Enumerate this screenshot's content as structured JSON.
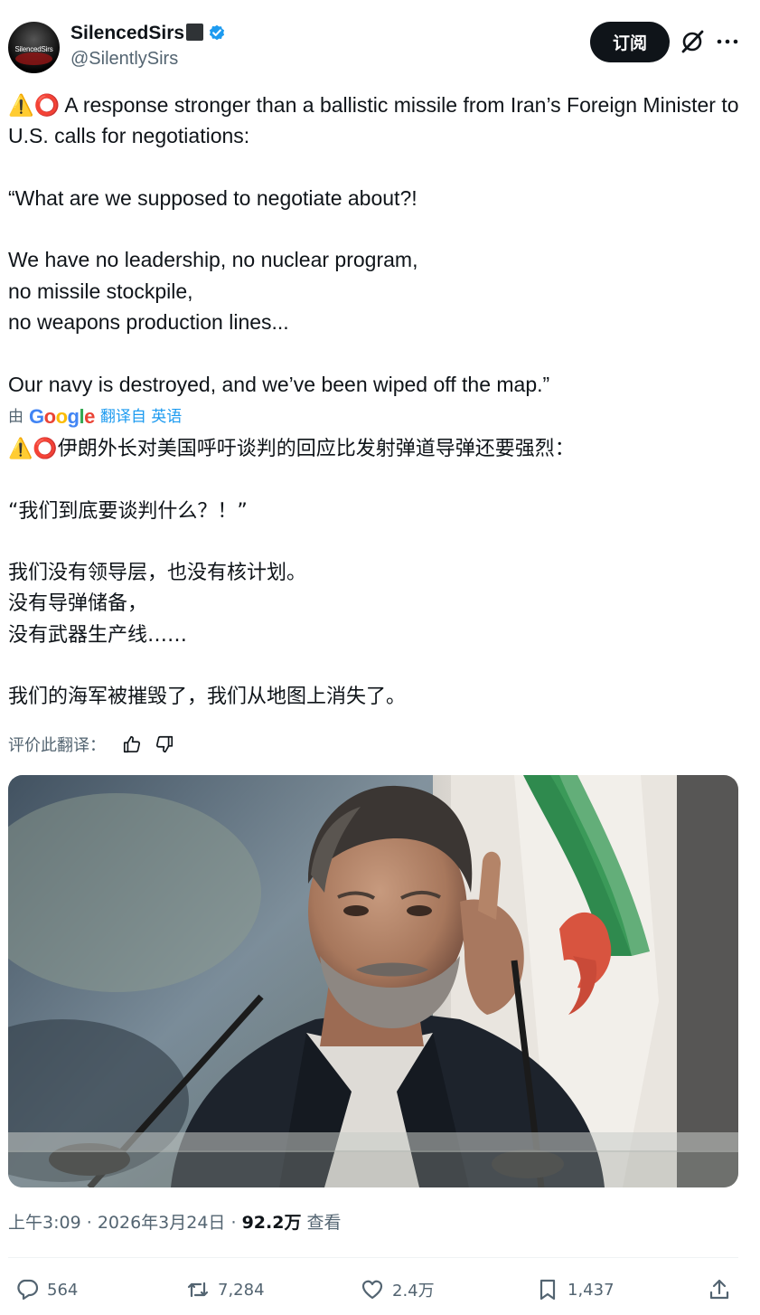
{
  "author": {
    "display_name": "SilencedSirs",
    "handle": "@SilentlySirs",
    "avatar_text": "SilencedSirs"
  },
  "header": {
    "subscribe_label": "订阅"
  },
  "tweet": {
    "text_en": "⚠️⭕ A response stronger than a ballistic missile from Iran’s Foreign Minister to U.S. calls for negotiations:\n\n“What are we supposed to negotiate about?!\n\nWe have no leadership, no nuclear program,\nno missile stockpile,\nno weapons production lines...\n\nOur navy is destroyed, and we’ve been wiped off the map.”",
    "translated_by_prefix": "由",
    "translated_by_brand": "Google",
    "translated_from": "翻译自 英语",
    "text_zh": "⚠️⭕伊朗外长对美国呼吁谈判的回应比发射弹道导弹还要强烈：\n\n“我们到底要谈判什么？！”\n\n我们没有领导层，也没有核计划。\n没有导弹储备，\n没有武器生产线……\n\n我们的海军被摧毁了，我们从地图上消失了。",
    "rate_translation_label": "评价此翻译："
  },
  "meta": {
    "time": "上午3:09",
    "separator": "·",
    "date": "2026年3月24日",
    "views": "92.2万",
    "views_label": "查看"
  },
  "actions": {
    "replies": "564",
    "retweets": "7,284",
    "likes": "2.4万",
    "bookmarks": "1,437"
  },
  "colors": {
    "accent": "#1d9bf0",
    "text": "#0f1419",
    "secondary": "#536471"
  }
}
